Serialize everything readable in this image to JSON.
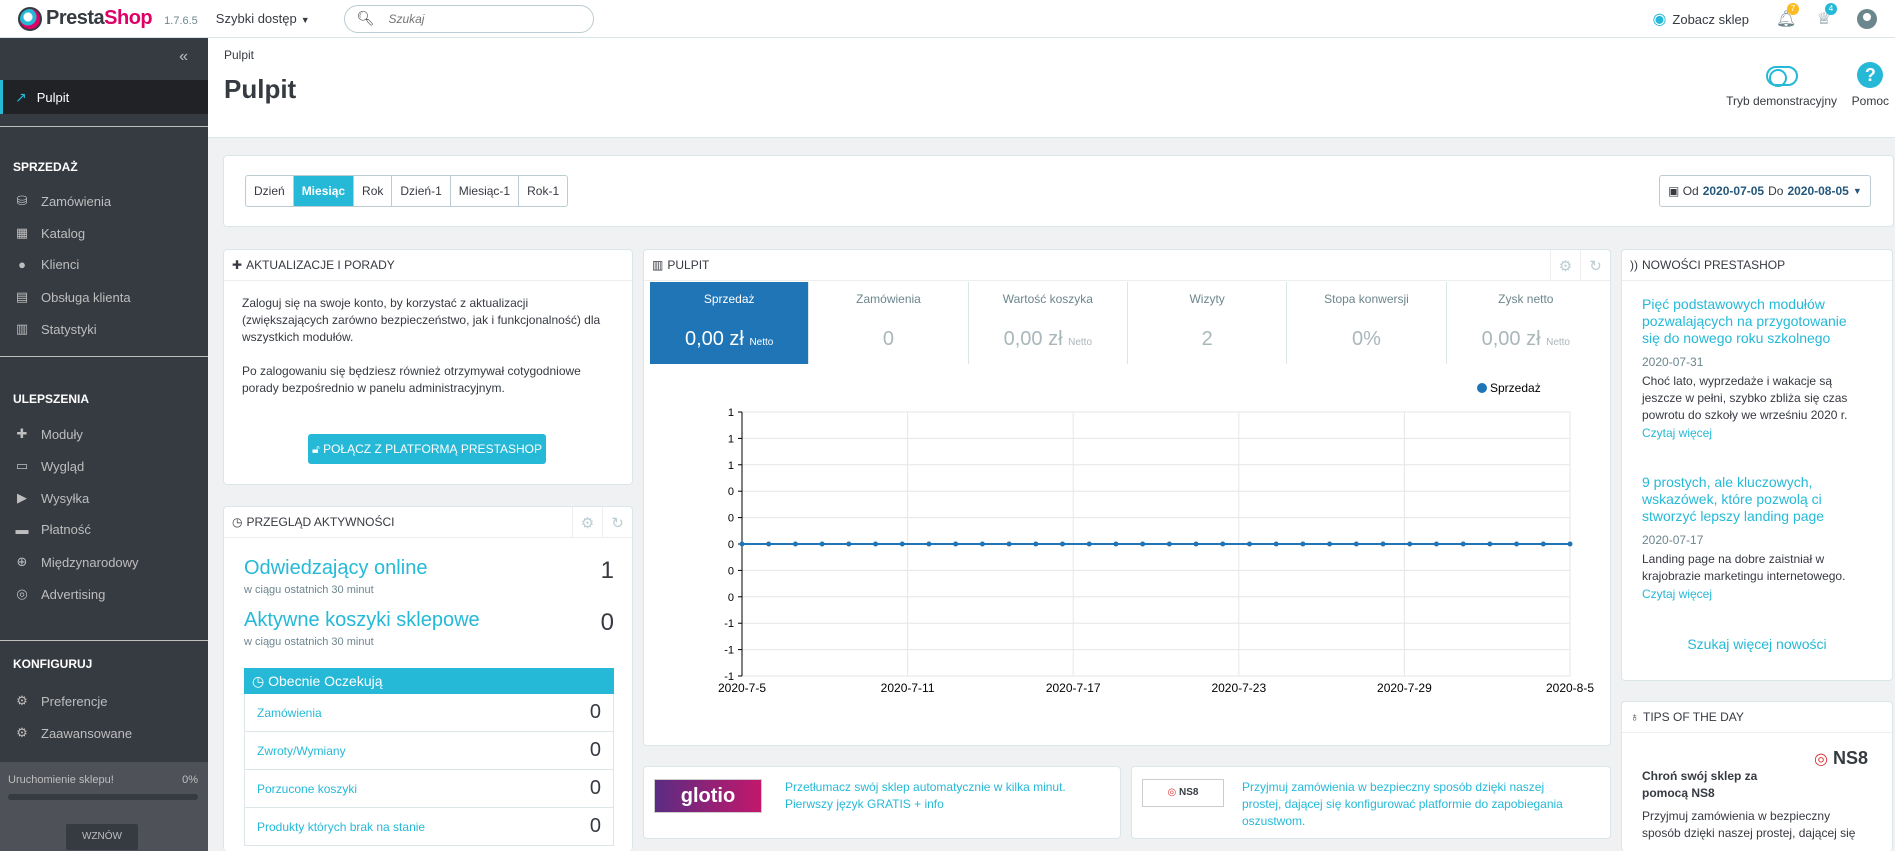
{
  "header": {
    "brand_left": "Presta",
    "brand_right": "Shop",
    "version": "1.7.6.5",
    "quick_access": "Szybki dostęp",
    "search_placeholder": "Szukaj",
    "view_shop": "Zobacz sklep",
    "notif_orders": "7",
    "notif_customers": "4"
  },
  "sidebar": {
    "active": "Pulpit",
    "sections": [
      {
        "title": "SPRZEDAŻ",
        "items": [
          {
            "label": "Zamówienia",
            "icon": "basket-icon"
          },
          {
            "label": "Katalog",
            "icon": "store-icon"
          },
          {
            "label": "Klienci",
            "icon": "user-icon"
          },
          {
            "label": "Obsługa klienta",
            "icon": "chat-icon"
          },
          {
            "label": "Statystyki",
            "icon": "bar-chart-icon"
          }
        ]
      },
      {
        "title": "ULEPSZENIA",
        "items": [
          {
            "label": "Moduły",
            "icon": "puzzle-icon"
          },
          {
            "label": "Wygląd",
            "icon": "monitor-icon"
          },
          {
            "label": "Wysyłka",
            "icon": "truck-icon"
          },
          {
            "label": "Płatność",
            "icon": "credit-card-icon"
          },
          {
            "label": "Międzynarodowy",
            "icon": "globe-icon"
          },
          {
            "label": "Advertising",
            "icon": "target-icon"
          }
        ]
      },
      {
        "title": "KONFIGURUJ",
        "items": [
          {
            "label": "Preferencje",
            "icon": "gear-icon"
          },
          {
            "label": "Zaawansowane",
            "icon": "settings-box-icon"
          }
        ]
      }
    ],
    "launch_label": "Uruchomienie sklepu!",
    "launch_percent": "0%",
    "launch_progress": 0,
    "resume": "WZNÓW"
  },
  "page": {
    "breadcrumb": "Pulpit",
    "title": "Pulpit",
    "demo_mode": "Tryb demonstracyjny",
    "help": "Pomoc"
  },
  "period": {
    "options": [
      "Dzień",
      "Miesiąc",
      "Rok",
      "Dzień-1",
      "Miesiąc-1",
      "Rok-1"
    ],
    "selected": "Miesiąc",
    "from_label": "Od",
    "from": "2020-07-05",
    "to_label": "Do",
    "to": "2020-08-05"
  },
  "updates": {
    "title": "AKTUALIZACJE I PORADY",
    "p1": "Zaloguj się na swoje konto, by korzystać z aktualizacji (zwiększających zarówno bezpieczeństwo, jak i funkcjonalność) dla wszystkich modułów.",
    "p2": "Po zalogowaniu się będziesz również otrzymywał cotygodniowe porady bezpośrednio w panelu administracyjnym.",
    "button": "POŁĄCZ Z PLATFORMĄ PRESTASHOP"
  },
  "activity": {
    "title": "PRZEGLĄD AKTYWNOŚCI",
    "online_label": "Odwiedzający online",
    "online_sub": "w ciągu ostatnich 30 minut",
    "online_value": "1",
    "carts_label": "Aktywne koszyki sklepowe",
    "carts_sub": "w ciągu ostatnich 30 minut",
    "carts_value": "0",
    "pending_title": "Obecnie Oczekują",
    "pending": [
      {
        "label": "Zamówienia",
        "value": "0"
      },
      {
        "label": "Zwroty/Wymiany",
        "value": "0"
      },
      {
        "label": "Porzucone koszyki",
        "value": "0"
      },
      {
        "label": "Produkty których brak na stanie",
        "value": "0"
      }
    ]
  },
  "dashboard": {
    "title": "PULPIT",
    "kpis": [
      {
        "label": "Sprzedaż",
        "value": "0,00 zł",
        "unit": "Netto",
        "active": true
      },
      {
        "label": "Zamówienia",
        "value": "0",
        "unit": ""
      },
      {
        "label": "Wartość koszyka",
        "value": "0,00 zł",
        "unit": "Netto"
      },
      {
        "label": "Wizyty",
        "value": "2",
        "unit": ""
      },
      {
        "label": "Stopa konwersji",
        "value": "0%",
        "unit": ""
      },
      {
        "label": "Zysk netto",
        "value": "0,00 zł",
        "unit": "Netto"
      }
    ]
  },
  "chart_data": {
    "type": "line",
    "series": [
      {
        "name": "Sprzedaż",
        "values": [
          0,
          0,
          0,
          0,
          0,
          0,
          0,
          0,
          0,
          0,
          0,
          0,
          0,
          0,
          0,
          0,
          0,
          0,
          0,
          0,
          0,
          0,
          0,
          0,
          0,
          0,
          0,
          0,
          0,
          0,
          0,
          0
        ]
      }
    ],
    "x_tick_labels": [
      "2020-7-5",
      "2020-7-11",
      "2020-7-17",
      "2020-7-23",
      "2020-7-29",
      "2020-8-5"
    ],
    "y_tick_labels": [
      "1",
      "1",
      "1",
      "0",
      "0",
      "0",
      "0",
      "0",
      "-1",
      "-1",
      "-1"
    ],
    "ylim": [
      -1,
      1
    ],
    "legend_position": "top-right",
    "grid": true,
    "color": "#1f75b6"
  },
  "news": {
    "title": "NOWOŚCI PRESTASHOP",
    "items": [
      {
        "title": "Pięć podstawowych modułów pozwalających na przygotowanie się do nowego roku szkolnego",
        "date": "2020-07-31",
        "desc": "Choć lato, wyprzedaże i wakacje są jeszcze w pełni, szybko zbliża się czas powrotu do szkoły we wrześniu 2020 r.",
        "more": "Czytaj więcej"
      },
      {
        "title": "9 prostych, ale kluczowych, wskazówek, które pozwolą ci stworzyć lepszy landing page",
        "date": "2020-07-17",
        "desc": "Landing page na dobre zaistniał w krajobrazie marketingu internetowego.",
        "more": "Czytaj więcej"
      }
    ],
    "more": "Szukaj więcej nowości"
  },
  "promos": {
    "glotio_logo": "glotio",
    "glotio_text": "Przetłumacz swój sklep automatycznie w kilka minut. Pierwszy język GRATIS + info",
    "ns8_logo": "NS8",
    "ns8_text": "Przyjmuj zamówienia w bezpieczny sposób dzięki naszej prostej, dającej się konfigurować platformie do zapobiegania oszustwom."
  },
  "tips": {
    "title": "TIPS OF THE DAY",
    "logo": "NS8",
    "heading": "Chroń swój sklep za pomocą NS8",
    "desc": "Przyjmuj zamówienia w bezpieczny sposób dzięki naszej prostej, dającej się"
  }
}
